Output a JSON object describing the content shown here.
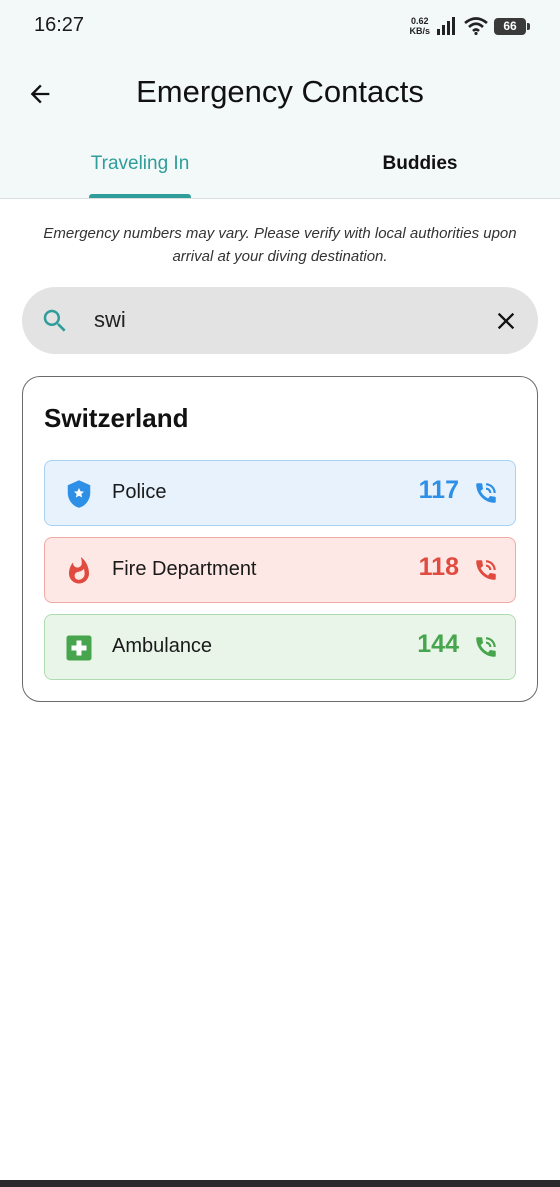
{
  "status_bar": {
    "time": "16:27",
    "net_speed_value": "0.62",
    "net_speed_unit": "KB/s",
    "battery_level": "66"
  },
  "header": {
    "title": "Emergency Contacts",
    "back_icon": "arrow-back-icon"
  },
  "tabs": [
    {
      "label": "Traveling In",
      "active": true
    },
    {
      "label": "Buddies",
      "active": false
    }
  ],
  "disclaimer": "Emergency numbers may vary. Please verify with local authorities upon arrival at your diving destination.",
  "search": {
    "value": "swi",
    "icon": "search-icon",
    "clear_icon": "close-icon"
  },
  "country": {
    "name": "Switzerland",
    "contacts": [
      {
        "label": "Police",
        "number": "117",
        "icon": "police-badge-icon",
        "color": "#2d8fe6",
        "bg": "#e7f2fd",
        "border": "#a9d1f3"
      },
      {
        "label": "Fire Department",
        "number": "118",
        "icon": "fire-icon",
        "color": "#e04a3f",
        "bg": "#fde8e6",
        "border": "#f1aaa4"
      },
      {
        "label": "Ambulance",
        "number": "144",
        "icon": "medical-cross-icon",
        "color": "#47a54d",
        "bg": "#e9f5e8",
        "border": "#b0dbb1"
      }
    ]
  },
  "colors": {
    "accent": "#2f9d99",
    "header_bg": "#f3f8f8",
    "search_bg": "#e3e3e3"
  }
}
